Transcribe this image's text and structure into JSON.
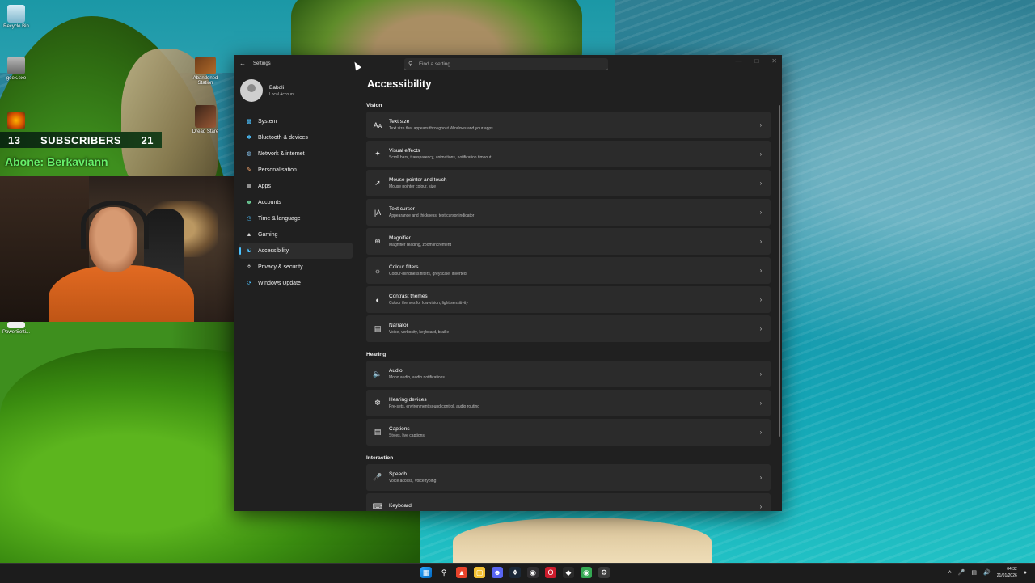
{
  "desktop": {
    "icons": [
      "Recycle Bin",
      "geek.exe",
      "Abandoned Station",
      "Dread Stare",
      "PowerSetti..."
    ],
    "overlay": {
      "subscribers_left": "13",
      "subscribers_label": "SUBSCRIBERS",
      "subscribers_right": "21",
      "abone": "Abone: Berkaviann"
    }
  },
  "window": {
    "app_title": "Settings",
    "back_icon": "back-arrow-icon",
    "search_placeholder": "Find a setting",
    "user": {
      "name": "Baboli",
      "account": "Local Account"
    },
    "nav": [
      {
        "label": "System",
        "icon": "display-icon"
      },
      {
        "label": "Bluetooth & devices",
        "icon": "bluetooth-icon"
      },
      {
        "label": "Network & internet",
        "icon": "wifi-icon"
      },
      {
        "label": "Personalisation",
        "icon": "brush-icon"
      },
      {
        "label": "Apps",
        "icon": "apps-icon"
      },
      {
        "label": "Accounts",
        "icon": "person-icon"
      },
      {
        "label": "Time & language",
        "icon": "globe-clock-icon"
      },
      {
        "label": "Gaming",
        "icon": "controller-icon"
      },
      {
        "label": "Accessibility",
        "icon": "accessibility-icon"
      },
      {
        "label": "Privacy & security",
        "icon": "shield-icon"
      },
      {
        "label": "Windows Update",
        "icon": "update-icon"
      }
    ],
    "active_nav": "Accessibility",
    "page_title": "Accessibility",
    "sections": [
      {
        "heading": "Vision",
        "items": [
          {
            "title": "Text size",
            "subtitle": "Text size that appears throughout Windows and your apps",
            "icon": "text-size-icon"
          },
          {
            "title": "Visual effects",
            "subtitle": "Scroll bars, transparency, animations, notification timeout",
            "icon": "sparkle-icon"
          },
          {
            "title": "Mouse pointer and touch",
            "subtitle": "Mouse pointer colour, size",
            "icon": "mouse-pointer-icon"
          },
          {
            "title": "Text cursor",
            "subtitle": "Appearance and thickness, text cursor indicator",
            "icon": "text-cursor-icon"
          },
          {
            "title": "Magnifier",
            "subtitle": "Magnifier reading, zoom increment",
            "icon": "magnifier-icon"
          },
          {
            "title": "Colour filters",
            "subtitle": "Colour-blindness filters, greyscale, inverted",
            "icon": "colour-filter-icon"
          },
          {
            "title": "Contrast themes",
            "subtitle": "Colour themes for low vision, light sensitivity",
            "icon": "contrast-icon"
          },
          {
            "title": "Narrator",
            "subtitle": "Voice, verbosity, keyboard, braille",
            "icon": "narrator-icon"
          }
        ]
      },
      {
        "heading": "Hearing",
        "items": [
          {
            "title": "Audio",
            "subtitle": "Mono audio, audio notifications",
            "icon": "speaker-icon"
          },
          {
            "title": "Hearing devices",
            "subtitle": "Pre-sets, environment sound control, audio routing",
            "icon": "ear-icon"
          },
          {
            "title": "Captions",
            "subtitle": "Styles, live captions",
            "icon": "captions-icon"
          }
        ]
      },
      {
        "heading": "Interaction",
        "items": [
          {
            "title": "Speech",
            "subtitle": "Voice access, voice typing",
            "icon": "microphone-icon"
          },
          {
            "title": "Keyboard",
            "subtitle": "",
            "icon": "keyboard-icon"
          }
        ]
      }
    ]
  },
  "taskbar": {
    "clock_time": "04:32",
    "clock_date": "21/01/2026"
  }
}
